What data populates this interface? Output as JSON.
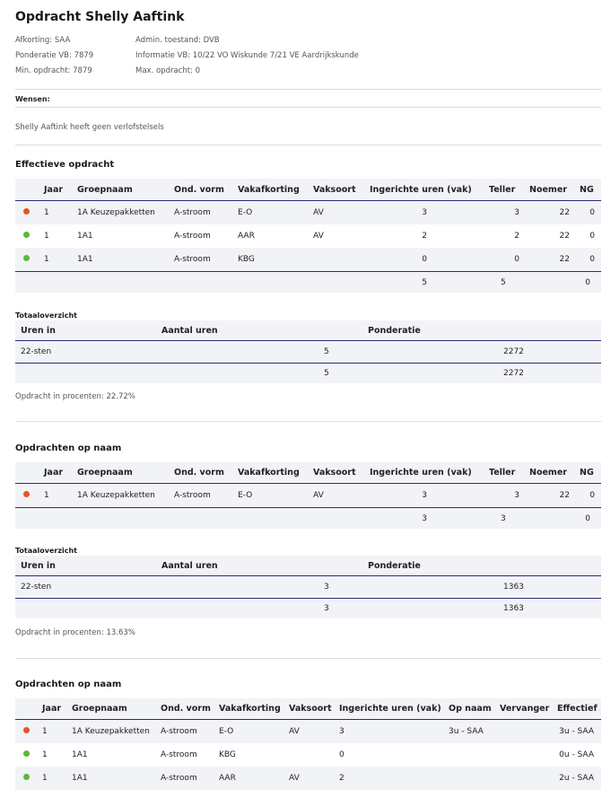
{
  "title": "Opdracht Shelly Aaftink",
  "meta": {
    "afkorting": "Afkorting: SAA",
    "ponderatie": "Ponderatie VB: 7879",
    "min_opdracht": "Min. opdracht: 7879",
    "admin_toestand": "Admin. toestand: DVB",
    "informatie": "Informatie VB: 10/22 VO Wiskunde 7/21 VE Aardrijkskunde",
    "max_opdracht": "Max. opdracht: 0"
  },
  "wensen_label": "Wensen:",
  "verlof_text": "Shelly Aaftink heeft geen verlofstelsels",
  "colors": {
    "red": "#e8522c",
    "green": "#5cb836",
    "header_line": "#2c2a7a",
    "row_grey": "#f2f3f6"
  },
  "effectief": {
    "title": "Effectieve opdracht",
    "headers": [
      "Jaar",
      "Groepnaam",
      "Ond. vorm",
      "Vakafkorting",
      "Vaksoort",
      "Ingerichte uren (vak)",
      "Teller",
      "Noemer",
      "NG"
    ],
    "rows": [
      {
        "status": "red",
        "icon": "red-status-dot-icon",
        "jaar": "1",
        "groep": "1A Keuzepakketten",
        "vorm": "A-stroom",
        "vak": "E-O",
        "soort": "AV",
        "uren": "3",
        "teller": "3",
        "noemer": "22",
        "ng": "0"
      },
      {
        "status": "green",
        "icon": "green-status-dot-icon",
        "jaar": "1",
        "groep": "1A1",
        "vorm": "A-stroom",
        "vak": "AAR",
        "soort": "AV",
        "uren": "2",
        "teller": "2",
        "noemer": "22",
        "ng": "0"
      },
      {
        "status": "green",
        "icon": "green-status-dot-icon",
        "jaar": "1",
        "groep": "1A1",
        "vorm": "A-stroom",
        "vak": "KBG",
        "soort": "",
        "uren": "0",
        "teller": "0",
        "noemer": "22",
        "ng": "0"
      }
    ],
    "totals": {
      "uren": "5",
      "teller": "5",
      "ng": "0"
    }
  },
  "totaal1": {
    "title": "Totaaloverzicht",
    "headers": [
      "Uren in",
      "Aantal uren",
      "Ponderatie"
    ],
    "rows": [
      {
        "uren_in": "22-sten",
        "aantal": "5",
        "ponderatie": "2272"
      }
    ],
    "totals": {
      "aantal": "5",
      "ponderatie": "2272"
    },
    "percent": "Opdracht in procenten: 22.72%"
  },
  "opnaam1": {
    "title": "Opdrachten op naam",
    "headers": [
      "Jaar",
      "Groepnaam",
      "Ond. vorm",
      "Vakafkorting",
      "Vaksoort",
      "Ingerichte uren (vak)",
      "Teller",
      "Noemer",
      "NG"
    ],
    "rows": [
      {
        "status": "red",
        "icon": "red-status-dot-icon",
        "jaar": "1",
        "groep": "1A Keuzepakketten",
        "vorm": "A-stroom",
        "vak": "E-O",
        "soort": "AV",
        "uren": "3",
        "teller": "3",
        "noemer": "22",
        "ng": "0"
      }
    ],
    "totals": {
      "uren": "3",
      "teller": "3",
      "ng": "0"
    }
  },
  "totaal2": {
    "title": "Totaaloverzicht",
    "headers": [
      "Uren in",
      "Aantal uren",
      "Ponderatie"
    ],
    "rows": [
      {
        "uren_in": "22-sten",
        "aantal": "3",
        "ponderatie": "1363"
      }
    ],
    "totals": {
      "aantal": "3",
      "ponderatie": "1363"
    },
    "percent": "Opdracht in procenten: 13.63%"
  },
  "opnaam2": {
    "title": "Opdrachten op naam",
    "headers": [
      "Jaar",
      "Groepnaam",
      "Ond. vorm",
      "Vakafkorting",
      "Vaksoort",
      "Ingerichte uren (vak)",
      "Op naam",
      "Vervanger",
      "Effectief"
    ],
    "rows": [
      {
        "status": "red",
        "icon": "red-status-dot-icon",
        "jaar": "1",
        "groep": "1A Keuzepakketten",
        "vorm": "A-stroom",
        "vak": "E-O",
        "soort": "AV",
        "uren": "3",
        "opnaam": "3u - SAA",
        "vervanger": "",
        "effectief": "3u - SAA"
      },
      {
        "status": "green",
        "icon": "green-status-dot-icon",
        "jaar": "1",
        "groep": "1A1",
        "vorm": "A-stroom",
        "vak": "KBG",
        "soort": "",
        "uren": "0",
        "opnaam": "",
        "vervanger": "",
        "effectief": "0u - SAA"
      },
      {
        "status": "green",
        "icon": "green-status-dot-icon",
        "jaar": "1",
        "groep": "1A1",
        "vorm": "A-stroom",
        "vak": "AAR",
        "soort": "AV",
        "uren": "2",
        "opnaam": "",
        "vervanger": "",
        "effectief": "2u - SAA"
      }
    ]
  }
}
